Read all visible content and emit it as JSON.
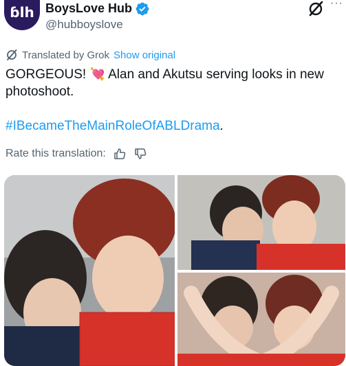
{
  "author": {
    "avatar_text": "ɓlh",
    "name": "BoysLove Hub",
    "handle": "@hubboyslove"
  },
  "header": {
    "more_label": "···"
  },
  "translation": {
    "translated_label": "Translated by Grok",
    "show_original": "Show original"
  },
  "tweet": {
    "text_before_emoji": "GORGEOUS! ",
    "emoji": "💘",
    "text_after_emoji": " Alan and Akutsu serving looks in new photoshoot.",
    "hashtag": "#IBecameTheMainRoleOfABLDrama",
    "hashtag_suffix": "."
  },
  "rate": {
    "label": "Rate this translation:"
  },
  "icons": {
    "verified": "verified-badge-icon",
    "grok": "grok-icon",
    "translate": "translate-icon",
    "thumbs_up": "thumbs-up-icon",
    "thumbs_down": "thumbs-down-icon"
  },
  "colors": {
    "accent": "#1d9bf0",
    "secondary_text": "#536471",
    "primary_text": "#0f1419",
    "avatar_bg": "#2a1a5e"
  }
}
